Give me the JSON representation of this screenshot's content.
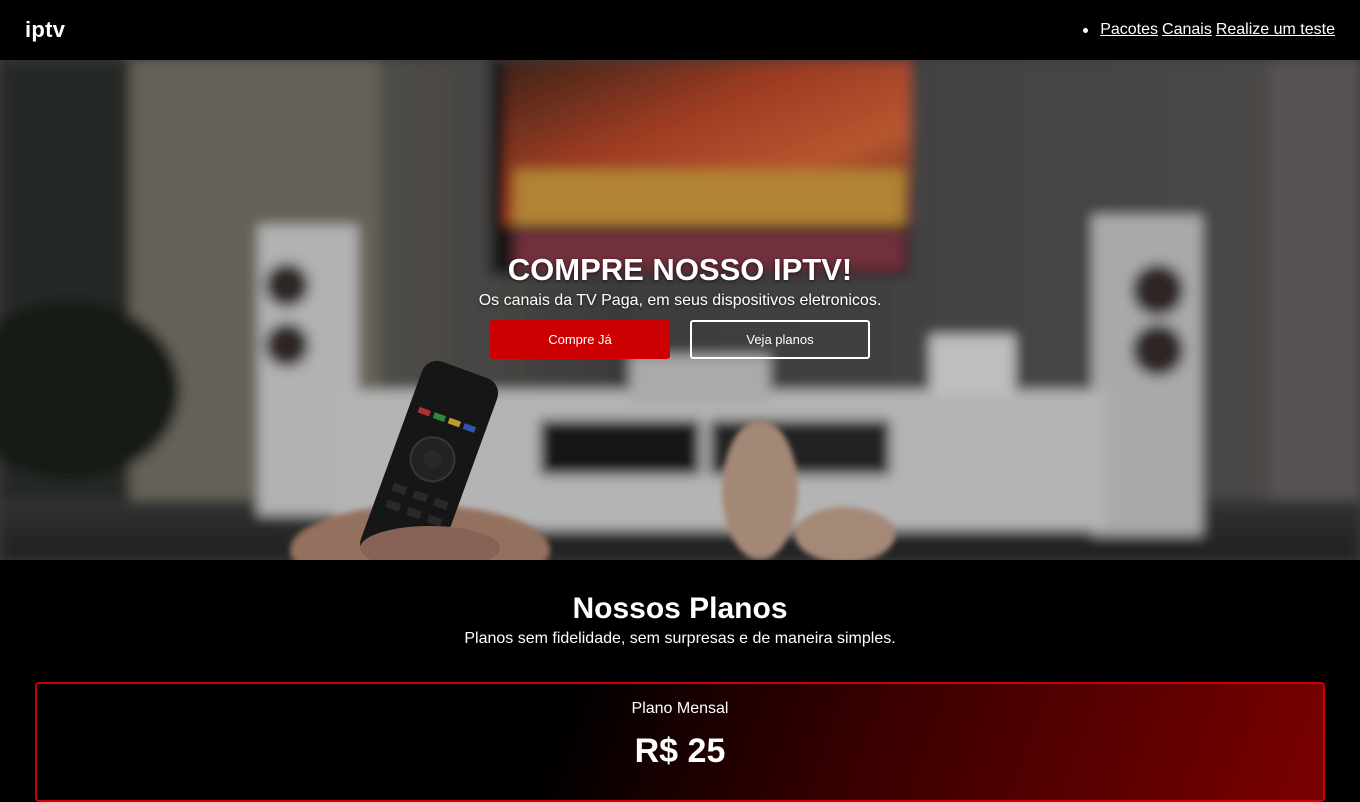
{
  "navbar": {
    "logo": "iptv",
    "links": [
      "Pacotes",
      "Canais",
      "Realize um teste"
    ]
  },
  "hero": {
    "title": "COMPRE NOSSO IPTV!",
    "subtitle": "Os canais da TV Paga, em seus dispositivos eletronicos.",
    "buy_label": "Compre Já",
    "plans_label": "Veja planos"
  },
  "plans": {
    "title": "Nossos Planos",
    "subtitle": "Planos sem fidelidade, sem surpresas e de maneira simples.",
    "card": {
      "name": "Plano Mensal",
      "price": "R$ 25"
    }
  },
  "colors": {
    "accent": "#cc0000",
    "background": "#000000"
  }
}
